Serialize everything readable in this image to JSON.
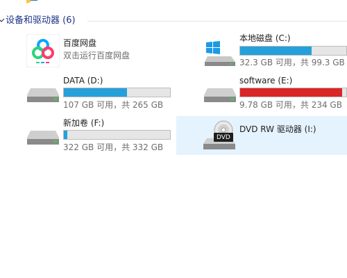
{
  "group": {
    "title": "设备和驱动器 (6)"
  },
  "colors": {
    "bar_normal": "#26a0da",
    "bar_full": "#da2626",
    "selection": "#e5f3ff"
  },
  "items": [
    {
      "name": "百度网盘",
      "sub": "双击运行百度网盘",
      "icon": "baidu-netdisk-icon"
    },
    {
      "name": "本地磁盘 (C:)",
      "sub": "32.3 GB 可用，共 99.3 GB",
      "icon": "windows-drive-icon",
      "used_fraction": 0.675
    },
    {
      "name": "DATA (D:)",
      "sub": "107 GB 可用，共 265 GB",
      "icon": "hard-drive-icon",
      "used_fraction": 0.596
    },
    {
      "name": "software (E:)",
      "sub": "9.78 GB 可用，共 234 GB",
      "icon": "hard-drive-icon",
      "used_fraction": 0.958
    },
    {
      "name": "新加卷 (F:)",
      "sub": "322 GB 可用，共 332 GB",
      "icon": "hard-drive-icon",
      "used_fraction": 0.03
    },
    {
      "name": "DVD RW 驱动器 (I:)",
      "icon": "dvd-drive-icon",
      "badge": "DVD"
    }
  ]
}
